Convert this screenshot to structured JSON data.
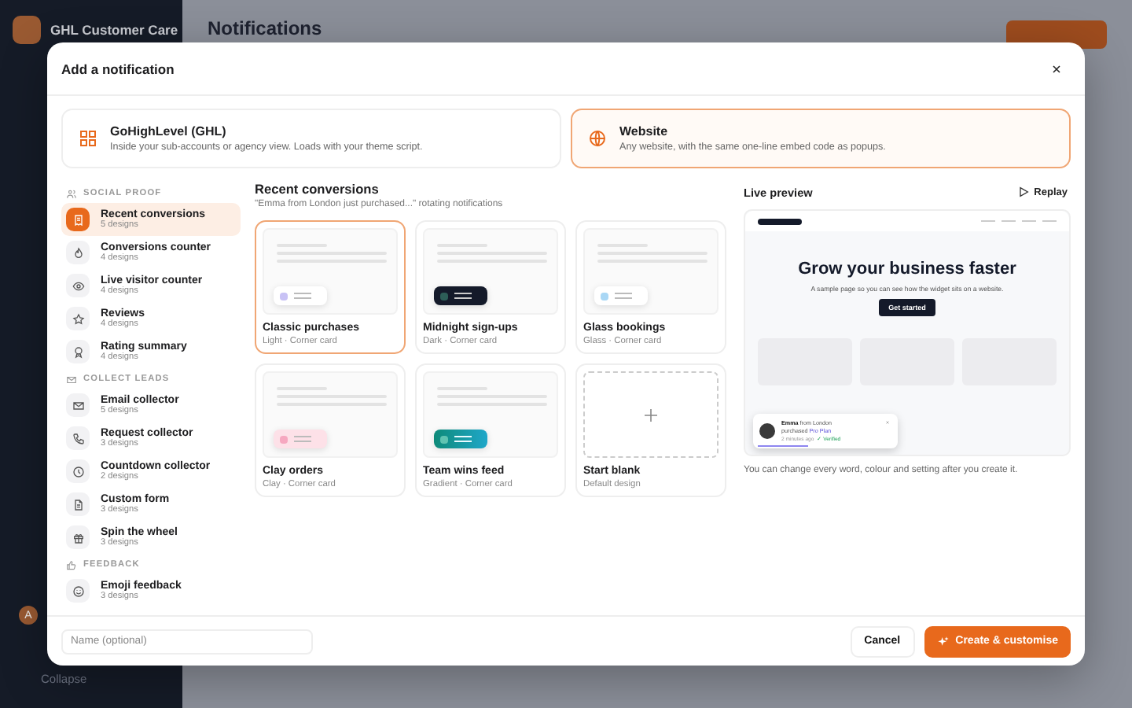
{
  "app": {
    "brand": "GHL Customer Care",
    "page_title": "Notifications",
    "collapse": "Collapse",
    "user_initial": "A"
  },
  "dialog": {
    "title": "Add a notification",
    "platforms": [
      {
        "kind": "ghl",
        "name": "GoHighLevel (GHL)",
        "description": "Inside your sub-accounts or agency view. Loads with your theme script.",
        "selected": false
      },
      {
        "kind": "web",
        "name": "Website",
        "description": "Any website, with the same one-line embed code as popups.",
        "selected": true
      }
    ],
    "groups": [
      {
        "kind": "people",
        "heading": "SOCIAL PROOF",
        "items": [
          {
            "kind": "receipt",
            "name": "Recent conversions",
            "count": "5 designs",
            "selected": true
          },
          {
            "kind": "flame",
            "name": "Conversions counter",
            "count": "4 designs",
            "selected": false
          },
          {
            "kind": "eye",
            "name": "Live visitor counter",
            "count": "4 designs",
            "selected": false
          },
          {
            "kind": "star",
            "name": "Reviews",
            "count": "4 designs",
            "selected": false
          },
          {
            "kind": "award",
            "name": "Rating summary",
            "count": "4 designs",
            "selected": false
          }
        ]
      },
      {
        "kind": "mail",
        "heading": "COLLECT LEADS",
        "items": [
          {
            "kind": "mail",
            "name": "Email collector",
            "count": "5 designs",
            "selected": false
          },
          {
            "kind": "phone",
            "name": "Request collector",
            "count": "3 designs",
            "selected": false
          },
          {
            "kind": "clock",
            "name": "Countdown collector",
            "count": "2 designs",
            "selected": false
          },
          {
            "kind": "file",
            "name": "Custom form",
            "count": "3 designs",
            "selected": false
          },
          {
            "kind": "gift",
            "name": "Spin the wheel",
            "count": "3 designs",
            "selected": false
          }
        ]
      },
      {
        "kind": "thumb",
        "heading": "FEEDBACK",
        "items": [
          {
            "kind": "smile",
            "name": "Emoji feedback",
            "count": "3 designs",
            "selected": false
          }
        ]
      }
    ],
    "category": {
      "title": "Recent conversions",
      "subtitle": "\"Emma from London just purchased...\" rotating notifications"
    },
    "designs": [
      {
        "kind": "light",
        "name": "Classic purchases",
        "meta": "Light · Corner card",
        "selected": true
      },
      {
        "kind": "dark",
        "name": "Midnight sign-ups",
        "meta": "Dark · Corner card",
        "selected": false
      },
      {
        "kind": "glass",
        "name": "Glass bookings",
        "meta": "Glass · Corner card",
        "selected": false
      },
      {
        "kind": "clay",
        "name": "Clay orders",
        "meta": "Clay · Corner card",
        "selected": false
      },
      {
        "kind": "gradient",
        "name": "Team wins feed",
        "meta": "Gradient · Corner card",
        "selected": false
      },
      {
        "kind": "blank",
        "name": "Start blank",
        "meta": "Default design",
        "selected": false
      }
    ],
    "preview": {
      "title": "Live preview",
      "replay": "Replay",
      "headline": "Grow your business faster",
      "subline": "A sample page so you can see how the widget sits on a website.",
      "cta": "Get started",
      "toast": {
        "name": "Emma",
        "line_1": "from London",
        "line_2": "purchased",
        "product": "Pro Plan",
        "time": "2 minutes ago",
        "badge": "✓ Verified"
      },
      "note": "You can change every word, colour and setting after you create it."
    },
    "name_field": {
      "placeholder": "Name (optional)"
    },
    "buttons": {
      "cancel": "Cancel",
      "create": "Create & customise"
    }
  }
}
